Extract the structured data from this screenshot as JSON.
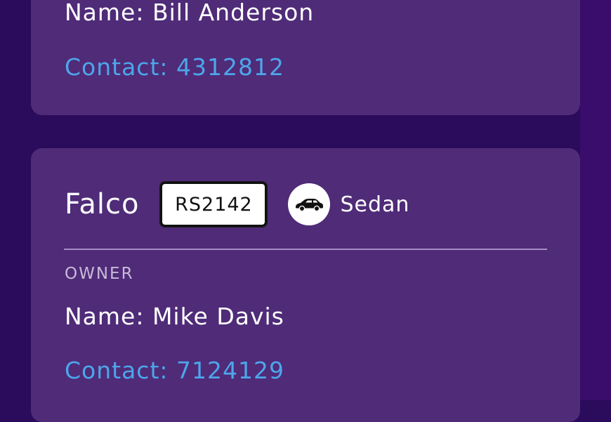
{
  "cards": [
    {
      "owner": {
        "name": "Name: Bill Anderson",
        "contact": "Contact: 4312812"
      }
    },
    {
      "vehicle": {
        "model": "Falco",
        "plate": "RS2142",
        "body_type": "Sedan",
        "icon": "car-icon"
      },
      "owner_label": "OWNER",
      "owner": {
        "name": "Name: Mike Davis",
        "contact": "Contact: 7124129"
      }
    }
  ],
  "colors": {
    "background": "#2b0b5c",
    "card": "#4f2b78",
    "contact_link": "#4da6ea",
    "label": "#c9bad9"
  }
}
